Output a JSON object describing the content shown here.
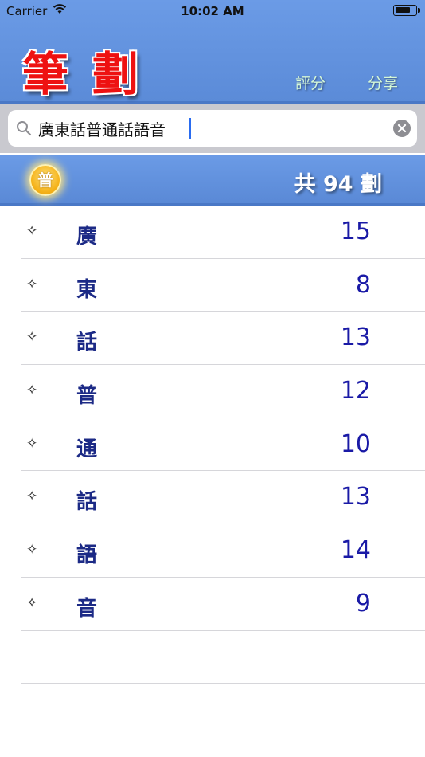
{
  "status_bar": {
    "carrier": "Carrier",
    "time": "10:02 AM"
  },
  "header": {
    "title": "筆劃",
    "rate_label": "評分",
    "share_label": "分享"
  },
  "search": {
    "value": "廣東話普通話語音"
  },
  "summary": {
    "mode_badge": "普",
    "total_label": "共 94 劃"
  },
  "characters": [
    {
      "char": "廣",
      "strokes": "15"
    },
    {
      "char": "東",
      "strokes": "8"
    },
    {
      "char": "話",
      "strokes": "13"
    },
    {
      "char": "普",
      "strokes": "12"
    },
    {
      "char": "通",
      "strokes": "10"
    },
    {
      "char": "話",
      "strokes": "13"
    },
    {
      "char": "語",
      "strokes": "14"
    },
    {
      "char": "音",
      "strokes": "9"
    }
  ],
  "row_marker": "✧",
  "colors": {
    "header_blue": "#5b8bd8",
    "title_red": "#ee1111",
    "stroke_blue": "#1a1aa6",
    "badge_gold": "#f5b21a"
  }
}
